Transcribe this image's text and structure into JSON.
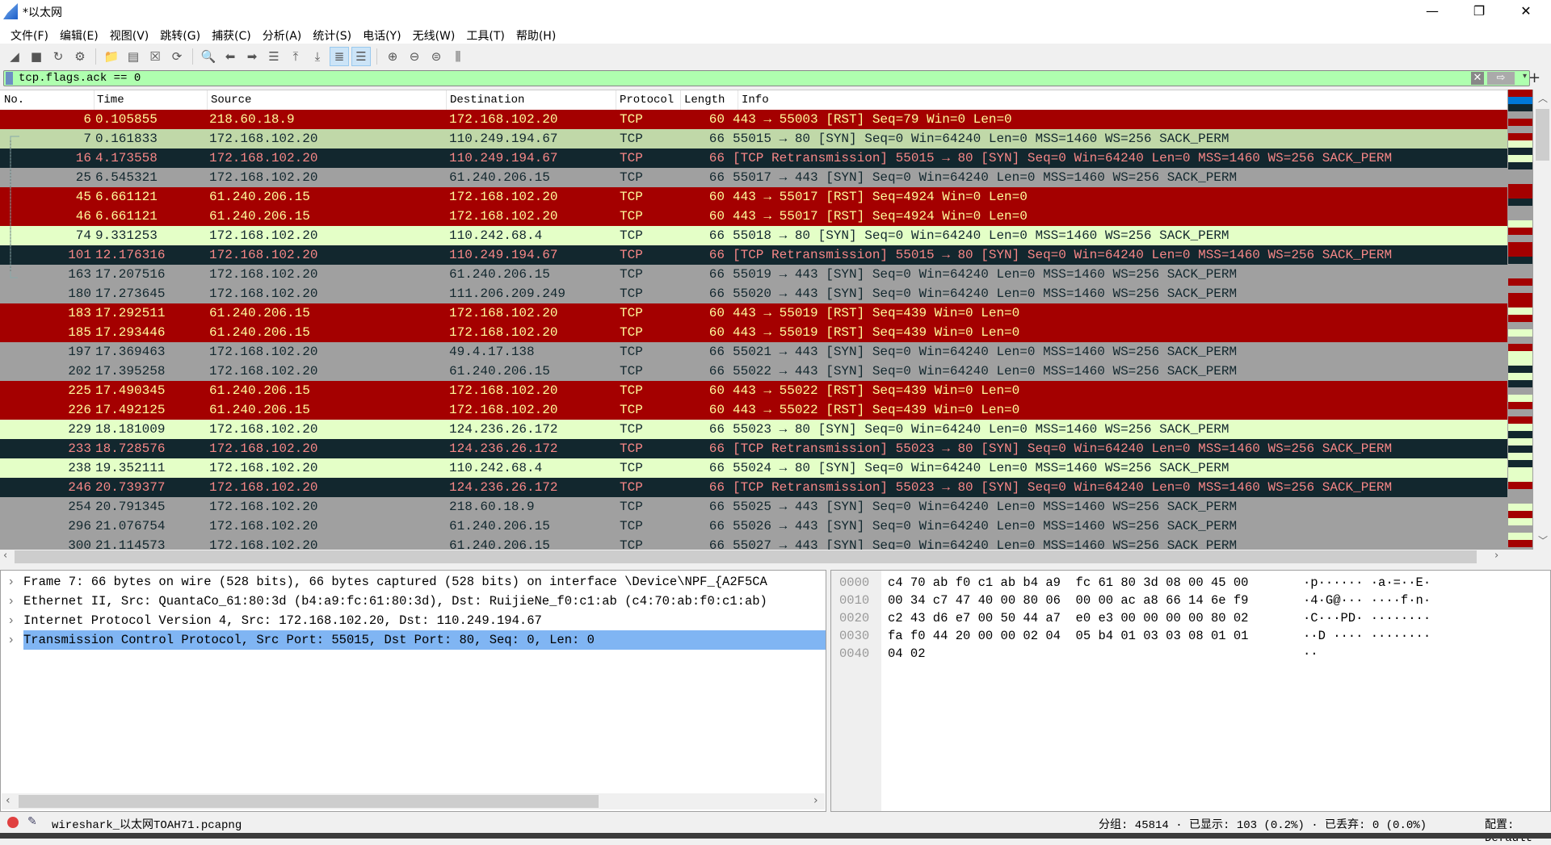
{
  "window": {
    "title": "*以太网",
    "minimize": "—",
    "maximize": "❐",
    "close": "✕"
  },
  "menu": [
    "文件(F)",
    "编辑(E)",
    "视图(V)",
    "跳转(G)",
    "捕获(C)",
    "分析(A)",
    "统计(S)",
    "电话(Y)",
    "无线(W)",
    "工具(T)",
    "帮助(H)"
  ],
  "toolbar": [
    {
      "name": "start-capture-icon",
      "glyph": "◢"
    },
    {
      "name": "stop-capture-icon",
      "glyph": "■"
    },
    {
      "name": "restart-capture-icon",
      "glyph": "↻"
    },
    {
      "name": "capture-options-icon",
      "glyph": "⚙"
    },
    {
      "sep": true
    },
    {
      "name": "open-file-icon",
      "glyph": "📁"
    },
    {
      "name": "save-file-icon",
      "glyph": "▤"
    },
    {
      "name": "close-file-icon",
      "glyph": "☒"
    },
    {
      "name": "reload-file-icon",
      "glyph": "⟳"
    },
    {
      "sep": true
    },
    {
      "name": "find-packet-icon",
      "glyph": "🔍"
    },
    {
      "name": "go-back-icon",
      "glyph": "⬅"
    },
    {
      "name": "go-forward-icon",
      "glyph": "➡"
    },
    {
      "name": "go-to-packet-icon",
      "glyph": "☰"
    },
    {
      "name": "go-first-icon",
      "glyph": "⤒"
    },
    {
      "name": "go-last-icon",
      "glyph": "⤓"
    },
    {
      "name": "autoscroll-icon",
      "glyph": "≣",
      "active": true
    },
    {
      "name": "colorize-icon",
      "glyph": "☰",
      "active": true
    },
    {
      "sep": true
    },
    {
      "name": "zoom-in-icon",
      "glyph": "⊕"
    },
    {
      "name": "zoom-out-icon",
      "glyph": "⊖"
    },
    {
      "name": "zoom-normal-icon",
      "glyph": "⊜"
    },
    {
      "name": "resize-columns-icon",
      "glyph": "⫼"
    }
  ],
  "filter": {
    "value": "tcp.flags.ack == 0",
    "clear_glyph": "✕",
    "apply_glyph": "⇨",
    "dropdown_glyph": "▾",
    "add_glyph": "+"
  },
  "columns": [
    "No.",
    "Time",
    "Source",
    "Destination",
    "Protocol",
    "Length",
    "Info"
  ],
  "colors": {
    "rst_bg": "#a40000",
    "rst_fg": "#fffc9c",
    "syn_bg": "#e4ffc7",
    "retx_bg": "#12272e",
    "retx_fg": "#f78787",
    "gray_bg": "#a0a0a0",
    "selected_bg": "#c0d8a8",
    "detail_highlight": "#80b5f3",
    "filter_ok": "#afffaf"
  },
  "packets": [
    {
      "no": "6",
      "time": "0.105855",
      "src": "218.60.18.9",
      "dst": "172.168.102.20",
      "proto": "TCP",
      "len": "60",
      "info": "443 → 55003 [RST] Seq=79 Win=0 Len=0",
      "style": "rst"
    },
    {
      "no": "7",
      "time": "0.161833",
      "src": "172.168.102.20",
      "dst": "110.249.194.67",
      "proto": "TCP",
      "len": "66",
      "info": "55015 → 80 [SYN] Seq=0 Win=64240 Len=0 MSS=1460 WS=256 SACK_PERM",
      "style": "sel",
      "selected": true
    },
    {
      "no": "16",
      "time": "4.173558",
      "src": "172.168.102.20",
      "dst": "110.249.194.67",
      "proto": "TCP",
      "len": "66",
      "info": "[TCP Retransmission] 55015 → 80 [SYN] Seq=0 Win=64240 Len=0 MSS=1460 WS=256 SACK_PERM",
      "style": "retx"
    },
    {
      "no": "25",
      "time": "6.545321",
      "src": "172.168.102.20",
      "dst": "61.240.206.15",
      "proto": "TCP",
      "len": "66",
      "info": "55017 → 443 [SYN] Seq=0 Win=64240 Len=0 MSS=1460 WS=256 SACK_PERM",
      "style": "gry"
    },
    {
      "no": "45",
      "time": "6.661121",
      "src": "61.240.206.15",
      "dst": "172.168.102.20",
      "proto": "TCP",
      "len": "60",
      "info": "443 → 55017 [RST] Seq=4924 Win=0 Len=0",
      "style": "rst"
    },
    {
      "no": "46",
      "time": "6.661121",
      "src": "61.240.206.15",
      "dst": "172.168.102.20",
      "proto": "TCP",
      "len": "60",
      "info": "443 → 55017 [RST] Seq=4924 Win=0 Len=0",
      "style": "rst"
    },
    {
      "no": "74",
      "time": "9.331253",
      "src": "172.168.102.20",
      "dst": "110.242.68.4",
      "proto": "TCP",
      "len": "66",
      "info": "55018 → 80 [SYN] Seq=0 Win=64240 Len=0 MSS=1460 WS=256 SACK_PERM",
      "style": "syn"
    },
    {
      "no": "101",
      "time": "12.176316",
      "src": "172.168.102.20",
      "dst": "110.249.194.67",
      "proto": "TCP",
      "len": "66",
      "info": "[TCP Retransmission] 55015 → 80 [SYN] Seq=0 Win=64240 Len=0 MSS=1460 WS=256 SACK_PERM",
      "style": "retx"
    },
    {
      "no": "163",
      "time": "17.207516",
      "src": "172.168.102.20",
      "dst": "61.240.206.15",
      "proto": "TCP",
      "len": "66",
      "info": "55019 → 443 [SYN] Seq=0 Win=64240 Len=0 MSS=1460 WS=256 SACK_PERM",
      "style": "gry"
    },
    {
      "no": "180",
      "time": "17.273645",
      "src": "172.168.102.20",
      "dst": "111.206.209.249",
      "proto": "TCP",
      "len": "66",
      "info": "55020 → 443 [SYN] Seq=0 Win=64240 Len=0 MSS=1460 WS=256 SACK_PERM",
      "style": "gry"
    },
    {
      "no": "183",
      "time": "17.292511",
      "src": "61.240.206.15",
      "dst": "172.168.102.20",
      "proto": "TCP",
      "len": "60",
      "info": "443 → 55019 [RST] Seq=439 Win=0 Len=0",
      "style": "rst"
    },
    {
      "no": "185",
      "time": "17.293446",
      "src": "61.240.206.15",
      "dst": "172.168.102.20",
      "proto": "TCP",
      "len": "60",
      "info": "443 → 55019 [RST] Seq=439 Win=0 Len=0",
      "style": "rst"
    },
    {
      "no": "197",
      "time": "17.369463",
      "src": "172.168.102.20",
      "dst": "49.4.17.138",
      "proto": "TCP",
      "len": "66",
      "info": "55021 → 443 [SYN] Seq=0 Win=64240 Len=0 MSS=1460 WS=256 SACK_PERM",
      "style": "gry"
    },
    {
      "no": "202",
      "time": "17.395258",
      "src": "172.168.102.20",
      "dst": "61.240.206.15",
      "proto": "TCP",
      "len": "66",
      "info": "55022 → 443 [SYN] Seq=0 Win=64240 Len=0 MSS=1460 WS=256 SACK_PERM",
      "style": "gry"
    },
    {
      "no": "225",
      "time": "17.490345",
      "src": "61.240.206.15",
      "dst": "172.168.102.20",
      "proto": "TCP",
      "len": "60",
      "info": "443 → 55022 [RST] Seq=439 Win=0 Len=0",
      "style": "rst"
    },
    {
      "no": "226",
      "time": "17.492125",
      "src": "61.240.206.15",
      "dst": "172.168.102.20",
      "proto": "TCP",
      "len": "60",
      "info": "443 → 55022 [RST] Seq=439 Win=0 Len=0",
      "style": "rst"
    },
    {
      "no": "229",
      "time": "18.181009",
      "src": "172.168.102.20",
      "dst": "124.236.26.172",
      "proto": "TCP",
      "len": "66",
      "info": "55023 → 80 [SYN] Seq=0 Win=64240 Len=0 MSS=1460 WS=256 SACK_PERM",
      "style": "syn"
    },
    {
      "no": "233",
      "time": "18.728576",
      "src": "172.168.102.20",
      "dst": "124.236.26.172",
      "proto": "TCP",
      "len": "66",
      "info": "[TCP Retransmission] 55023 → 80 [SYN] Seq=0 Win=64240 Len=0 MSS=1460 WS=256 SACK_PERM",
      "style": "retx"
    },
    {
      "no": "238",
      "time": "19.352111",
      "src": "172.168.102.20",
      "dst": "110.242.68.4",
      "proto": "TCP",
      "len": "66",
      "info": "55024 → 80 [SYN] Seq=0 Win=64240 Len=0 MSS=1460 WS=256 SACK_PERM",
      "style": "syn"
    },
    {
      "no": "246",
      "time": "20.739377",
      "src": "172.168.102.20",
      "dst": "124.236.26.172",
      "proto": "TCP",
      "len": "66",
      "info": "[TCP Retransmission] 55023 → 80 [SYN] Seq=0 Win=64240 Len=0 MSS=1460 WS=256 SACK_PERM",
      "style": "retx"
    },
    {
      "no": "254",
      "time": "20.791345",
      "src": "172.168.102.20",
      "dst": "218.60.18.9",
      "proto": "TCP",
      "len": "66",
      "info": "55025 → 443 [SYN] Seq=0 Win=64240 Len=0 MSS=1460 WS=256 SACK_PERM",
      "style": "gry"
    },
    {
      "no": "296",
      "time": "21.076754",
      "src": "172.168.102.20",
      "dst": "61.240.206.15",
      "proto": "TCP",
      "len": "66",
      "info": "55026 → 443 [SYN] Seq=0 Win=64240 Len=0 MSS=1460 WS=256 SACK_PERM",
      "style": "gry"
    },
    {
      "no": "300",
      "time": "21.114573",
      "src": "172.168.102.20",
      "dst": "61.240.206.15",
      "proto": "TCP",
      "len": "66",
      "info": "55027 → 443 [SYN] Seq=0 Win=64240 Len=0 MSS=1460 WS=256 SACK_PERM",
      "style": "gry"
    }
  ],
  "details": [
    {
      "text": "Frame 7: 66 bytes on wire (528 bits), 66 bytes captured (528 bits) on interface \\Device\\NPF_{A2F5CA"
    },
    {
      "text": "Ethernet II, Src: QuantaCo_61:80:3d (b4:a9:fc:61:80:3d), Dst: RuijieNe_f0:c1:ab (c4:70:ab:f0:c1:ab)"
    },
    {
      "text": "Internet Protocol Version 4, Src: 172.168.102.20, Dst: 110.249.194.67"
    },
    {
      "text": "Transmission Control Protocol, Src Port: 55015, Dst Port: 80, Seq: 0, Len: 0",
      "selected": true
    }
  ],
  "hex": [
    {
      "offset": "0000",
      "bytes": "c4 70 ab f0 c1 ab b4 a9  fc 61 80 3d 08 00 45 00",
      "ascii": "·p······ ·a·=··E·"
    },
    {
      "offset": "0010",
      "bytes": "00 34 c7 47 40 00 80 06  00 00 ac a8 66 14 6e f9",
      "ascii": "·4·G@··· ····f·n·"
    },
    {
      "offset": "0020",
      "bytes": "c2 43 d6 e7 00 50 44 a7  e0 e3 00 00 00 00 80 02",
      "ascii": "·C···PD· ········"
    },
    {
      "offset": "0030",
      "bytes": "fa f0 44 20 00 00 02 04  05 b4 01 03 03 08 01 01",
      "ascii": "··D ···· ········"
    },
    {
      "offset": "0040",
      "bytes": "04 02",
      "ascii": "··"
    }
  ],
  "status": {
    "file": "wireshark_以太网TOAH71.pcapng",
    "stats": "分组: 45814 · 已显示: 103 (0.2%) · 已丢弃: 0 (0.0%)",
    "profile": "配置: Default"
  }
}
